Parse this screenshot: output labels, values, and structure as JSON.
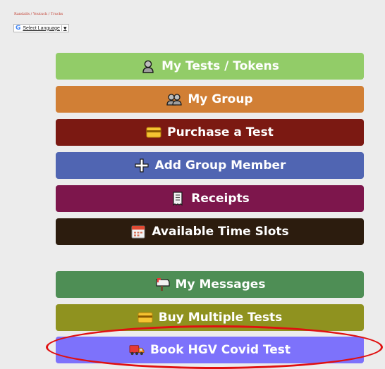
{
  "breadcrumb": "Randalls / Youtuck / Trucks",
  "translate": {
    "logo": "G",
    "label": "Select Language",
    "arrow": "▼"
  },
  "menu": [
    {
      "label": "My Tests / Tokens",
      "icon": "person-icon",
      "color": "#92cc68"
    },
    {
      "label": "My Group",
      "icon": "group-icon",
      "color": "#d17f35"
    },
    {
      "label": "Purchase a Test",
      "icon": "credit-card-icon",
      "color": "#7b1912"
    },
    {
      "label": "Add Group Member",
      "icon": "plus-icon",
      "color": "#5065b2"
    },
    {
      "label": "Receipts",
      "icon": "receipt-icon",
      "color": "#7d164c"
    },
    {
      "label": "Available Time Slots",
      "icon": "calendar-icon",
      "color": "#2c1c0e"
    },
    {
      "label": "My Messages",
      "icon": "mailbox-icon",
      "color": "#4e8e55"
    },
    {
      "label": "Buy Multiple Tests",
      "icon": "credit-card-icon",
      "color": "#8f921f"
    },
    {
      "label": "Book HGV Covid Test",
      "icon": "truck-icon",
      "color": "#7d72fb"
    }
  ],
  "annotation": {
    "color": "#e01010",
    "target": "Book HGV Covid Test"
  }
}
